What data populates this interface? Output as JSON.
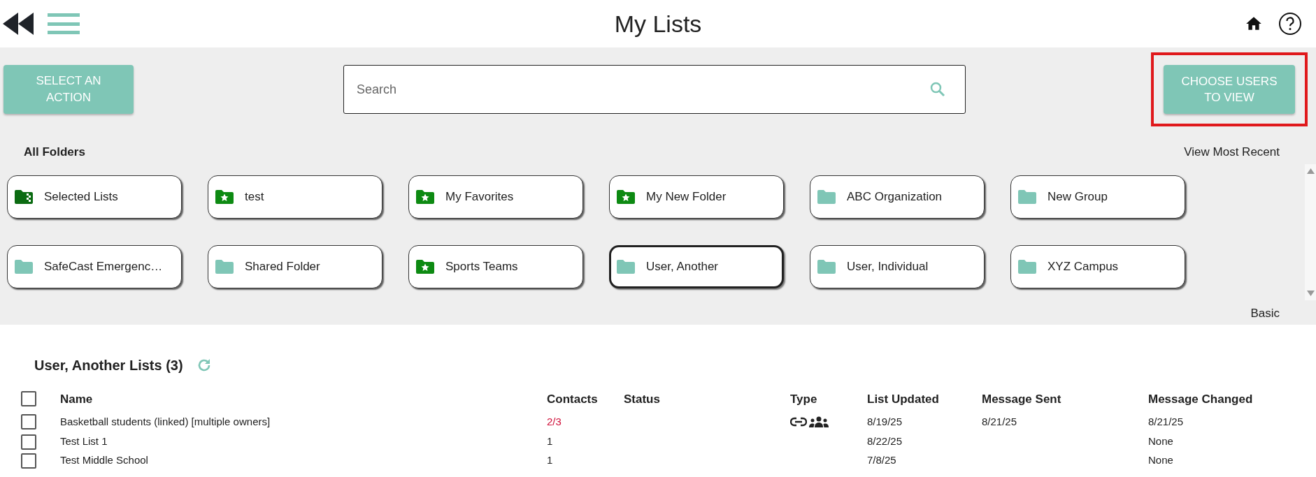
{
  "header": {
    "title": "My Lists"
  },
  "actions": {
    "select_action": "SELECT AN ACTION",
    "search": {
      "placeholder": "Search"
    },
    "choose_users": "CHOOSE USERS TO VIEW",
    "choose_users_highlighted": true
  },
  "folders": {
    "heading": "All Folders",
    "view_link": "View Most Recent",
    "mode_link": "Basic",
    "items": [
      {
        "label": "Selected Lists",
        "kind": "selection",
        "selected": false
      },
      {
        "label": "test",
        "kind": "starred",
        "selected": false
      },
      {
        "label": "My Favorites",
        "kind": "starred",
        "selected": false
      },
      {
        "label": "My New Folder",
        "kind": "starred",
        "selected": false
      },
      {
        "label": "ABC Organization",
        "kind": "plain",
        "selected": false
      },
      {
        "label": "New Group",
        "kind": "plain",
        "selected": false
      },
      {
        "label": "SafeCast Emergenc…",
        "kind": "plain",
        "selected": false
      },
      {
        "label": "Shared Folder",
        "kind": "plain",
        "selected": false
      },
      {
        "label": "Sports Teams",
        "kind": "starred",
        "selected": false
      },
      {
        "label": "User, Another",
        "kind": "plain",
        "selected": true
      },
      {
        "label": "User, Individual",
        "kind": "plain",
        "selected": false
      },
      {
        "label": "XYZ Campus",
        "kind": "plain",
        "selected": false
      }
    ]
  },
  "lists": {
    "title": "User, Another Lists (3)",
    "columns": [
      "Name",
      "Contacts",
      "Status",
      "Type",
      "List Updated",
      "Message Sent",
      "Message Changed"
    ],
    "header_checked": false,
    "rows": [
      {
        "checked": false,
        "name": "Basketball students (linked) [multiple owners]",
        "contacts": "2/3",
        "contacts_partial": true,
        "linked": true,
        "shared": true,
        "list_updated": "8/19/25",
        "message_sent": "8/21/25",
        "message_changed": "8/21/25"
      },
      {
        "checked": false,
        "name": "Test List 1",
        "contacts": "1",
        "contacts_partial": false,
        "linked": false,
        "shared": false,
        "list_updated": "8/22/25",
        "message_sent": "",
        "message_changed": "None"
      },
      {
        "checked": false,
        "name": "Test Middle School",
        "contacts": "1",
        "contacts_partial": false,
        "linked": false,
        "shared": false,
        "list_updated": "7/8/25",
        "message_sent": "",
        "message_changed": "None"
      }
    ]
  }
}
